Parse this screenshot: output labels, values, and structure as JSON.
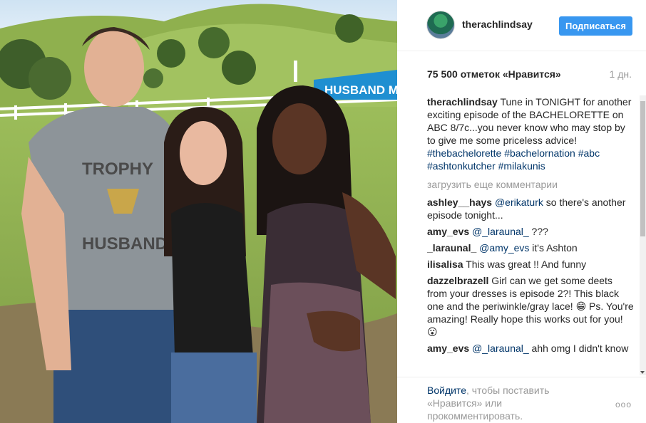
{
  "post": {
    "username": "therachlindsay",
    "follow_label": "Подписаться",
    "likes": "75 500 отметок «Нравится»",
    "time_ago": "1 дн.",
    "photo_sign_text": "HUSBAND MA"
  },
  "caption": {
    "author": "therachlindsay",
    "text": "Tune in TONIGHT for another exciting episode of the BACHELORETTE on ABC 8/7c...you never know who may stop by to give me some priceless advice! ",
    "tags": [
      "#thebachelorette",
      "#bachelornation",
      "#abc",
      "#ashtonkutcher",
      "#milakunis"
    ]
  },
  "load_more": "загрузить еще комментарии",
  "comments": [
    {
      "author": "ashley__hays",
      "mention": "@erikaturk",
      "text": " so there's another episode tonight..."
    },
    {
      "author": "amy_evs",
      "mention": "@_laraunal_",
      "text": " ???"
    },
    {
      "author": "_laraunal_",
      "mention": "@amy_evs",
      "text": " it's Ashton"
    },
    {
      "author": "ilisalisa",
      "mention": "",
      "text": "This was great !! And funny"
    },
    {
      "author": "dazzelbrazell",
      "mention": "",
      "text": "Girl can we get some deets from your dresses is episode 2?! This black one and the periwinkle/gray lace! 😁 Ps. You're amazing! Really hope this works out for you! 😮"
    },
    {
      "author": "amy_evs",
      "mention": "@_laraunal_",
      "text": " ahh omg I didn't know"
    }
  ],
  "footer": {
    "login_link": "Войдите",
    "login_text": ", чтобы поставить «Нравится» или прокомментировать.",
    "more_icon": "ooo"
  },
  "colors": {
    "link": "#003569",
    "follow_button": "#3897f0",
    "muted": "#999999"
  }
}
